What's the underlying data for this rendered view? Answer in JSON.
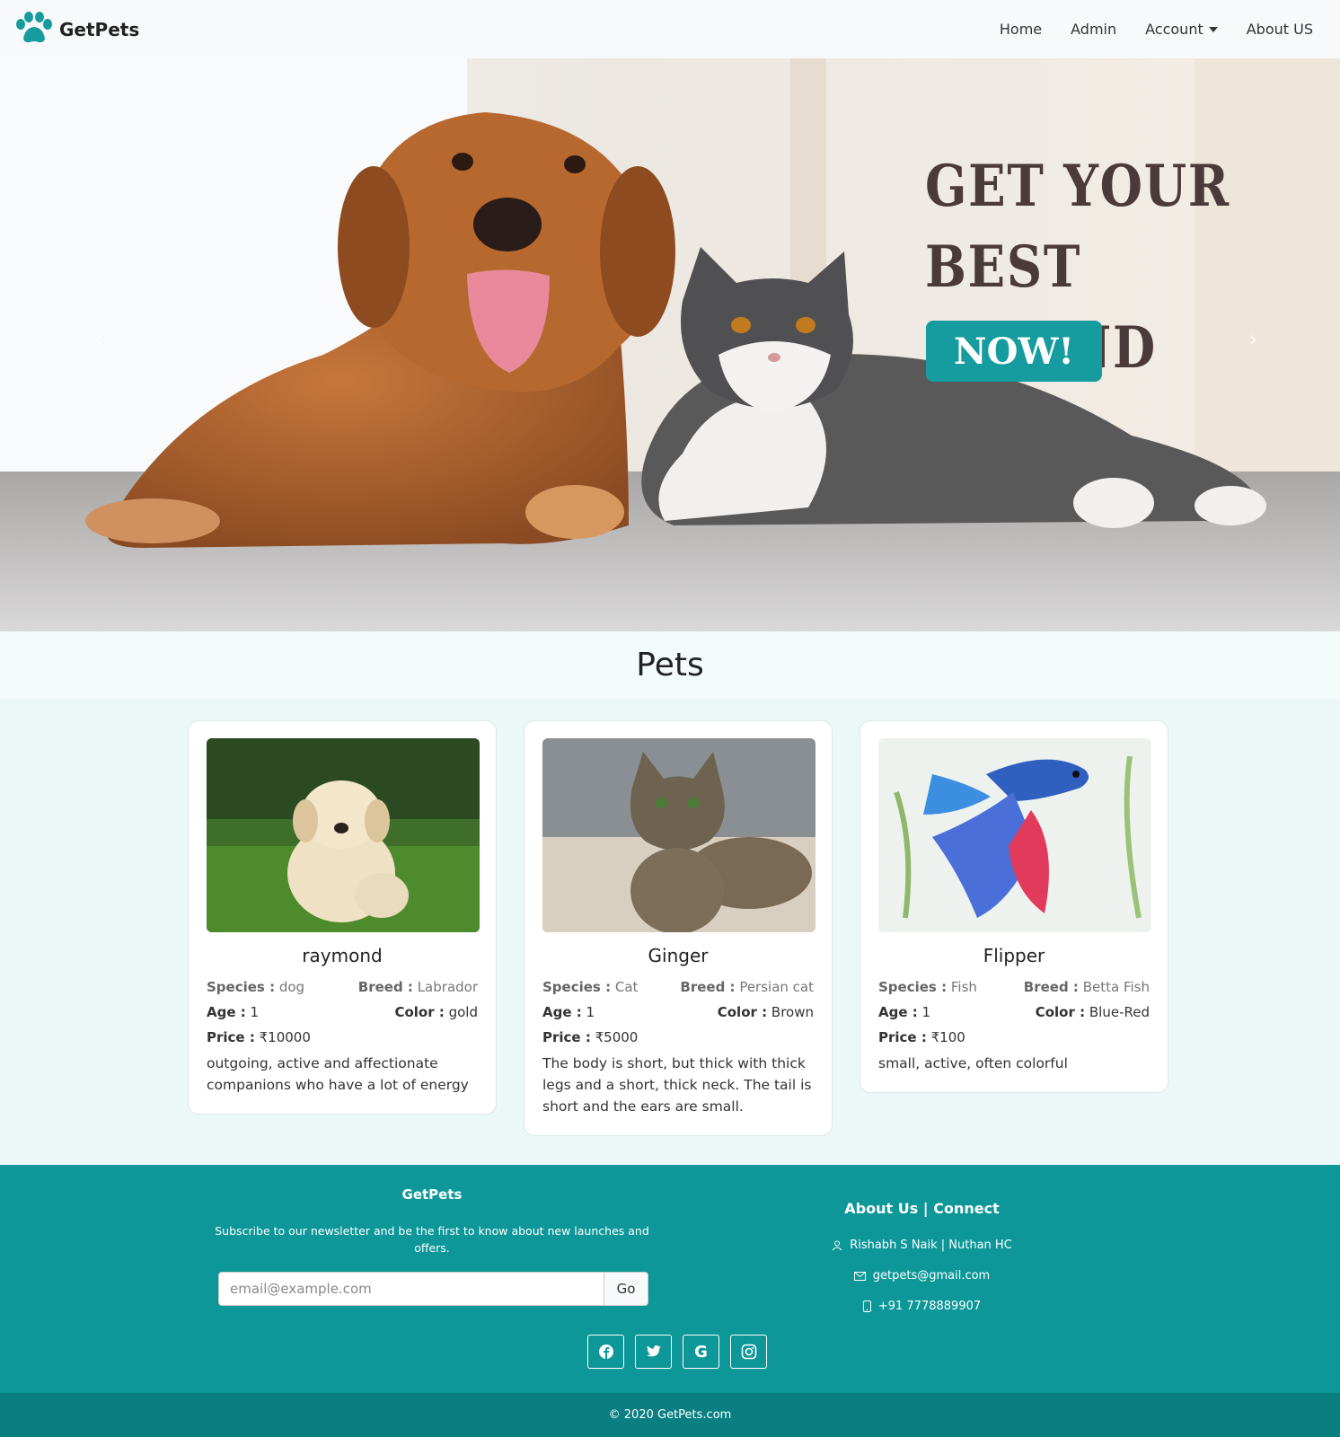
{
  "navbar": {
    "brand": "GetPets",
    "links": {
      "home": "Home",
      "admin": "Admin",
      "account": "Account",
      "about": "About US"
    }
  },
  "hero": {
    "title_line1": "GET YOUR",
    "title_line2": "BEST FRIEND",
    "button": "NOW!"
  },
  "pets_section": {
    "title": "Pets"
  },
  "pets": [
    {
      "name": "raymond",
      "species_label": "Species :",
      "species": "dog",
      "breed_label": "Breed :",
      "breed": "Labrador",
      "age_label": "Age :",
      "age": "1",
      "color_label": "Color :",
      "color": "gold",
      "price_label": "Price :",
      "price": "₹10000",
      "description": "outgoing, active and affectionate companions who have a lot of energy"
    },
    {
      "name": "Ginger",
      "species_label": "Species :",
      "species": "Cat",
      "breed_label": "Breed :",
      "breed": "Persian cat",
      "age_label": "Age :",
      "age": "1",
      "color_label": "Color :",
      "color": "Brown",
      "price_label": "Price :",
      "price": "₹5000",
      "description": "The body is short, but thick with thick legs and a short, thick neck. The tail is short and the ears are small."
    },
    {
      "name": "Flipper",
      "species_label": "Species :",
      "species": "Fish",
      "breed_label": "Breed :",
      "breed": "Betta Fish",
      "age_label": "Age :",
      "age": "1",
      "color_label": "Color :",
      "color": "Blue-Red",
      "price_label": "Price :",
      "price": "₹100",
      "description": "small, active, often colorful"
    }
  ],
  "footer": {
    "brand": "GetPets",
    "subscribe_text": "Subscribe to our newsletter and be the first to know about new launches and offers.",
    "email_placeholder": "email@example.com",
    "go_button": "Go",
    "about_title": "About Us | Connect",
    "names": "Rishabh S Naik | Nuthan HC",
    "email": "getpets@gmail.com",
    "phone": "+91 7778889907",
    "socials": [
      "facebook-icon",
      "twitter-icon",
      "google-icon",
      "instagram-icon"
    ],
    "copyright": "© 2020 GetPets.com"
  },
  "colors": {
    "accent": "#169c9e",
    "footer": "#0d9799",
    "bottom_bar": "#0a7f82",
    "page_bg": "#ecf8f8"
  }
}
